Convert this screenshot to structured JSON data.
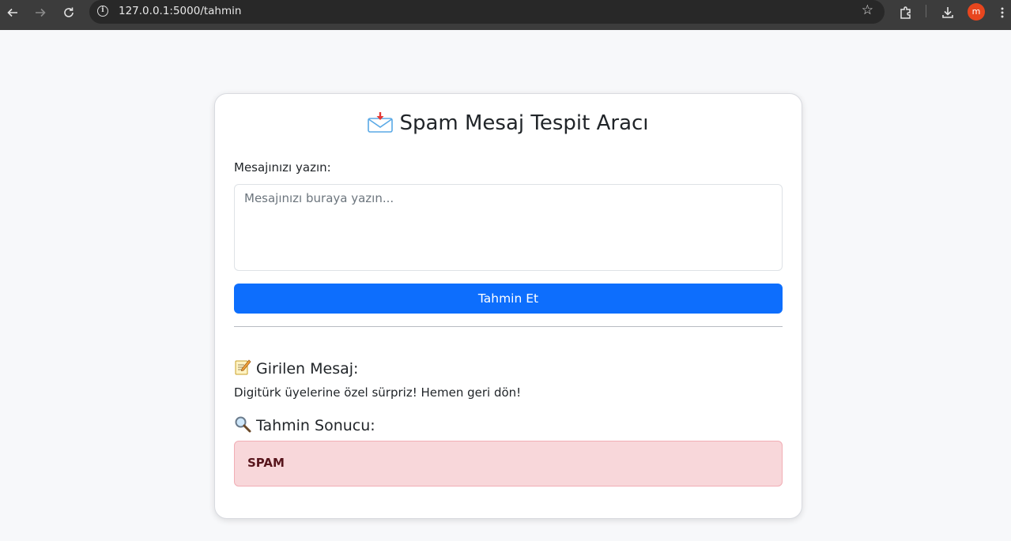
{
  "browser": {
    "url": "127.0.0.1:5000/tahmin",
    "avatar_letter": "m",
    "icons": [
      "back-icon",
      "forward-icon",
      "reload-icon",
      "site-info-icon",
      "bookmark-star-icon",
      "extensions-icon",
      "download-icon",
      "menu-icon"
    ]
  },
  "page": {
    "title": "Spam Mesaj Tespit Aracı",
    "title_icon": "incoming-envelope-icon",
    "input_label": "Mesajınızı yazın:",
    "input_placeholder": "Mesajınızı buraya yazın...",
    "input_value": "",
    "submit_label": "Tahmin Et",
    "entered_heading": "Girilen Mesaj:",
    "entered_icon": "memo-icon",
    "entered_message": "Digitürk üyelerine özel sürpriz! Hemen geri dön!",
    "result_heading": "Tahmin Sonucu:",
    "result_icon": "magnifier-icon",
    "result_value": "SPAM"
  },
  "colors": {
    "primary_button": "#0d6efd",
    "alert_background": "#f8d7da",
    "alert_text": "#58151c",
    "avatar": "#e8461e"
  }
}
